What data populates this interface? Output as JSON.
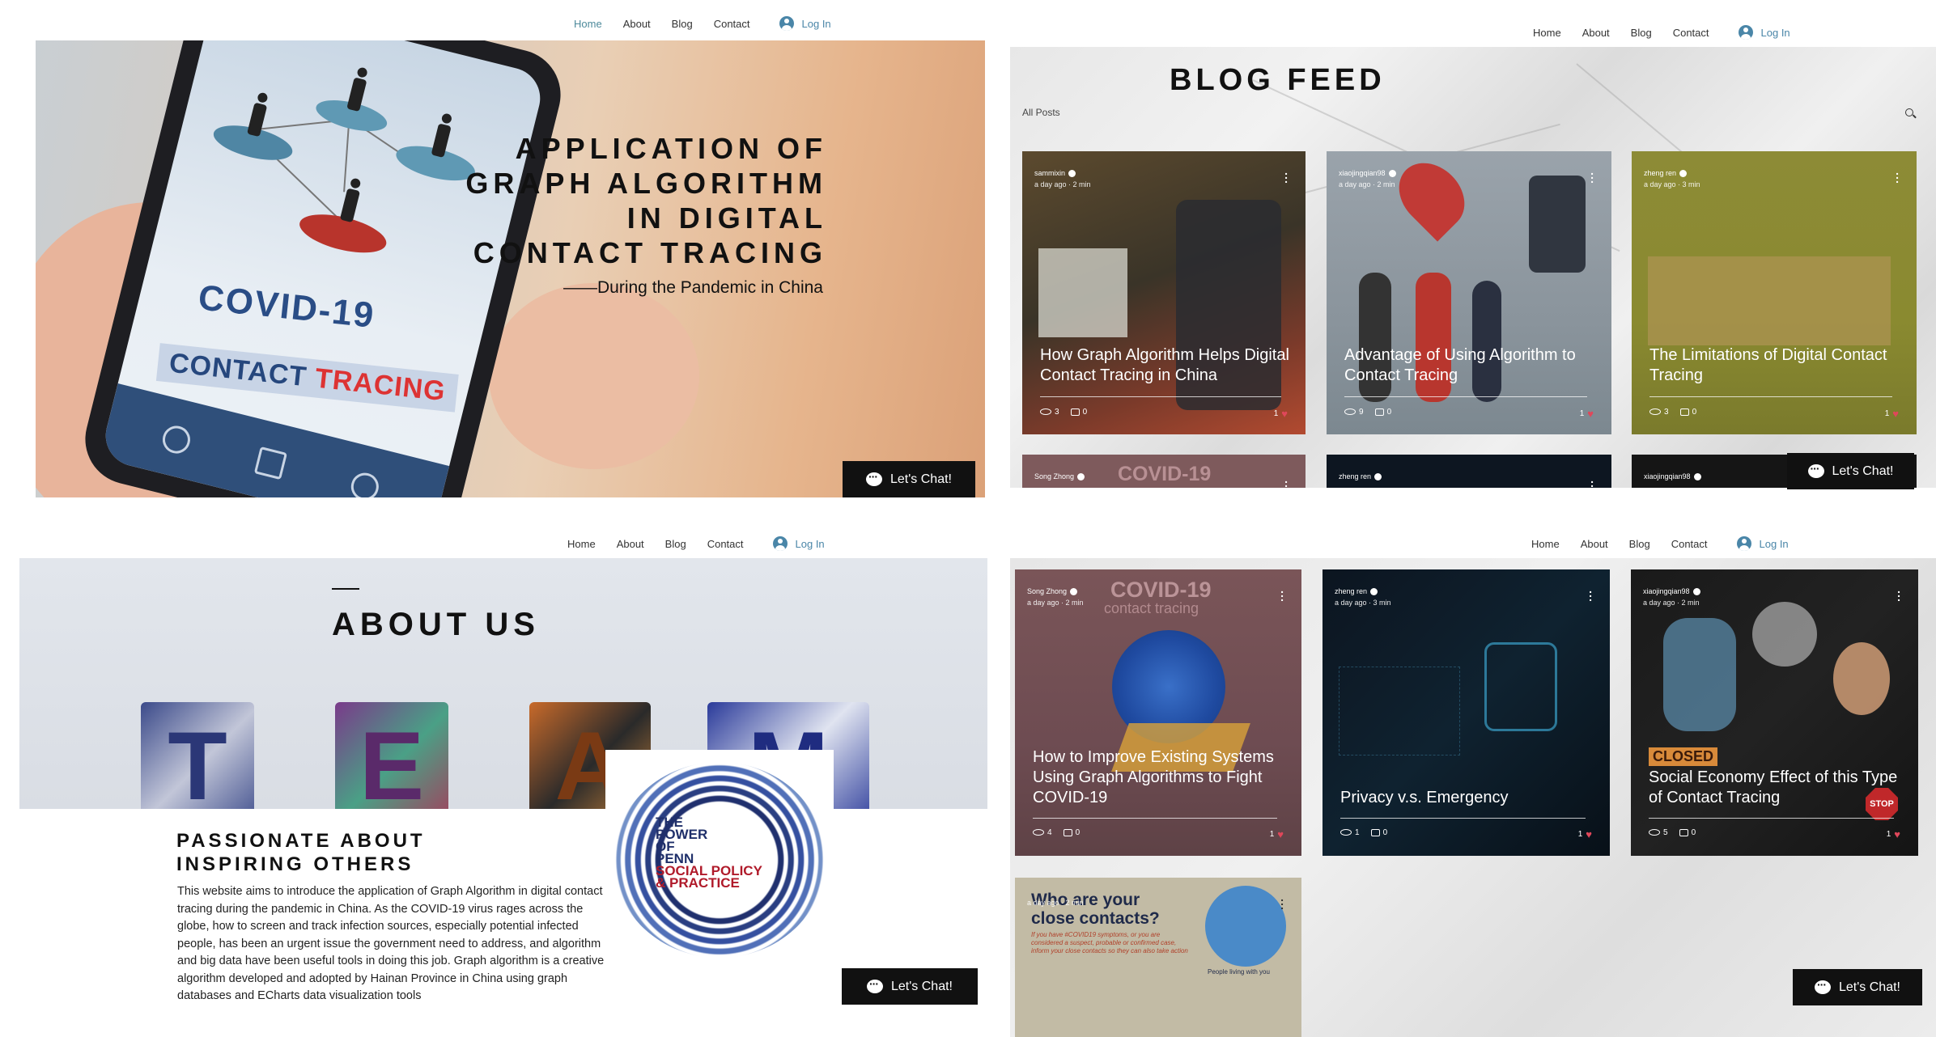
{
  "nav": {
    "home": "Home",
    "about": "About",
    "blog": "Blog",
    "contact": "Contact",
    "login": "Log In"
  },
  "chat": {
    "label": "Let's Chat!"
  },
  "hero": {
    "title_lines": [
      "APPLICATION OF",
      "GRAPH ALGORITHM",
      "IN DIGITAL",
      "CONTACT TRACING"
    ],
    "subtitle": "——During the Pandemic in China",
    "phone_text_1": "COVID-19",
    "phone_text_2a": "CONTACT ",
    "phone_text_2b": "TRACING"
  },
  "blog_feed": {
    "title": "BLOG FEED",
    "filter": "All Posts",
    "posts": [
      {
        "author": "sammixin",
        "meta": "a day ago · 2 min",
        "title": "How Graph Algorithm Helps Digital Contact Tracing in China",
        "views": "3",
        "comments": "0",
        "likes": "1"
      },
      {
        "author": "xiaojingqian98",
        "meta": "a day ago · 2 min",
        "title": "Advantage of Using Algorithm to Contact Tracing",
        "views": "9",
        "comments": "0",
        "likes": "1"
      },
      {
        "author": "zheng ren",
        "meta": "a day ago · 3 min",
        "title": "The Limitations of Digital Contact Tracing",
        "views": "3",
        "comments": "0",
        "likes": "1"
      }
    ],
    "peek_authors": [
      "Song Zhong",
      "zheng ren",
      "xiaojingqian98"
    ],
    "peek_text": "COVID-19"
  },
  "about": {
    "title": "ABOUT US",
    "letters": [
      "T",
      "E",
      "A",
      "M"
    ],
    "passion_lines": [
      "PASSIONATE ABOUT",
      "INSPIRING OTHERS"
    ],
    "body": "This website aims to introduce the application of Graph Algorithm in digital contact tracing during the pandemic in China. As the COVID-19 virus rages across the globe, how to screen and track infection sources, especially potential infected people, has been an urgent issue the government need to address, and algorithm and big data have been useful tools in doing this job. Graph algorithm is a creative algorithm developed and adopted by Hainan Province in China using graph databases and ECharts data visualization tools",
    "logo_lines": [
      "THE",
      "POWER",
      "OF",
      "PENN",
      "SOCIAL POLICY",
      "& PRACTICE"
    ]
  },
  "posts2": [
    {
      "author": "Song Zhong",
      "meta": "a day ago · 2 min",
      "title": "How to Improve Existing Systems Using Graph Algorithms to Fight COVID-19",
      "views": "4",
      "comments": "0",
      "likes": "1",
      "art_text_1": "COVID-19",
      "art_text_2": "contact tracing"
    },
    {
      "author": "zheng ren",
      "meta": "a day ago · 3 min",
      "title": "Privacy v.s. Emergency",
      "views": "1",
      "comments": "0",
      "likes": "1"
    },
    {
      "author": "xiaojingqian98",
      "meta": "a day ago · 2 min",
      "title": "Social Economy Effect of this Type of Contact Tracing",
      "views": "5",
      "comments": "0",
      "likes": "1",
      "art_text_1": "CLOSED",
      "art_text_2": "STOP"
    },
    {
      "author": "",
      "meta": "a day ago · 2 min",
      "title": "Who are your close contacts?",
      "art_text_1": "If you have #COVID19 symptoms, or you are considered a suspect, probable or confirmed case, inform your close contacts so they can also take action",
      "art_text_2": "People living with you"
    }
  ],
  "colors": {
    "accent": "#4a86a8",
    "heart": "#e0475a",
    "card_olive": "#8b8a2e",
    "card_mauve": "#7e5a5c",
    "card_dark": "#0d1621"
  }
}
